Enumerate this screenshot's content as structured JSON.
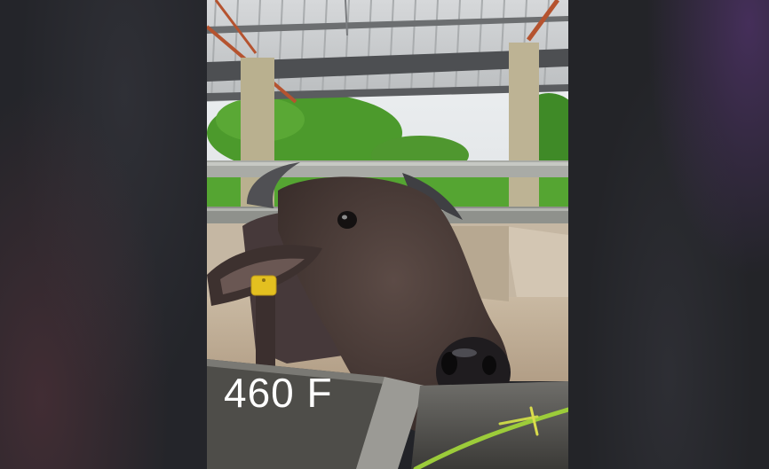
{
  "photo": {
    "caption": "460 F",
    "colors": {
      "sky": "#e9ecef",
      "foliage": "#4f9a2e",
      "roof": "#c9ccce",
      "rail": "#a5a7a2",
      "pen_wall": "#cbbba7",
      "buffalo": "#4a3c38",
      "ear_tag": "#e3c020"
    },
    "icons": [
      "ear-tag-icon"
    ]
  }
}
